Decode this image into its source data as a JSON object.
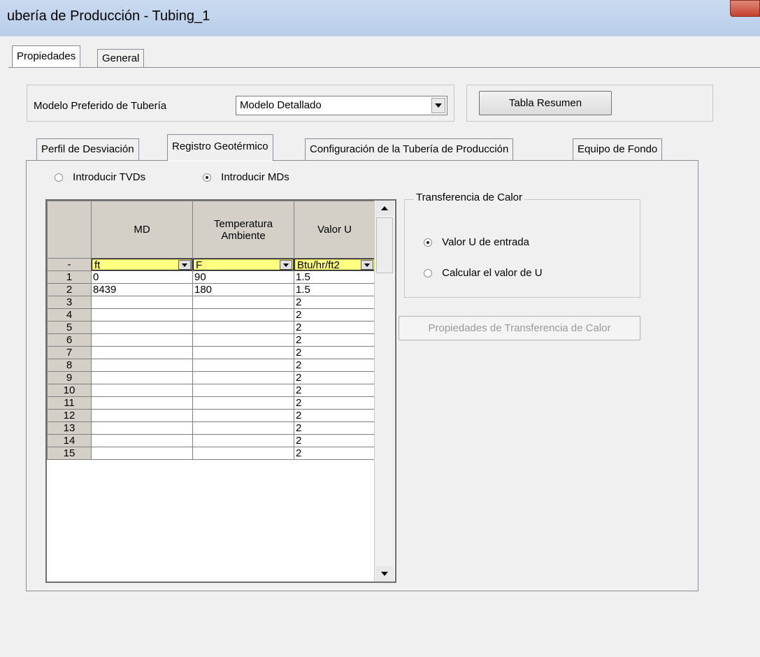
{
  "window": {
    "title": "ubería de Producción - Tubing_1"
  },
  "outer_tabs": [
    {
      "label": "Propiedades",
      "active": true
    },
    {
      "label": "General",
      "active": false
    }
  ],
  "model": {
    "label": "Modelo Preferido de Tubería",
    "selected": "Modelo Detallado",
    "summary_button": "Tabla Resumen"
  },
  "inner_tabs": [
    {
      "label": "Perfil de Desviación",
      "active": false
    },
    {
      "label": "Registro Geotérmico",
      "active": true
    },
    {
      "label": "Configuración de la Tubería de Producción",
      "active": false
    },
    {
      "label": "Equipo de Fondo",
      "active": false
    }
  ],
  "input_mode": {
    "options": [
      "Introducir TVDs",
      "Introducir MDs"
    ],
    "selected": "Introducir MDs"
  },
  "heat_transfer": {
    "group_label": "Transferencia de Calor",
    "options": [
      "Valor U de entrada",
      "Calcular el valor de U"
    ],
    "selected": "Valor U de entrada",
    "properties_button": "Propiedades de Transferencia de Calor"
  },
  "table": {
    "columns": [
      "MD",
      "Temperatura Ambiente",
      "Valor U"
    ],
    "unit_row_label": "-",
    "units": [
      "ft",
      "F",
      "Btu/hr/ft2"
    ],
    "rows": [
      {
        "n": "1",
        "md": "0",
        "temp": "90",
        "u": "1.5"
      },
      {
        "n": "2",
        "md": "8439",
        "temp": "180",
        "u": "1.5"
      },
      {
        "n": "3",
        "md": "",
        "temp": "",
        "u": "2"
      },
      {
        "n": "4",
        "md": "",
        "temp": "",
        "u": "2"
      },
      {
        "n": "5",
        "md": "",
        "temp": "",
        "u": "2"
      },
      {
        "n": "6",
        "md": "",
        "temp": "",
        "u": "2"
      },
      {
        "n": "7",
        "md": "",
        "temp": "",
        "u": "2"
      },
      {
        "n": "8",
        "md": "",
        "temp": "",
        "u": "2"
      },
      {
        "n": "9",
        "md": "",
        "temp": "",
        "u": "2"
      },
      {
        "n": "10",
        "md": "",
        "temp": "",
        "u": "2"
      },
      {
        "n": "11",
        "md": "",
        "temp": "",
        "u": "2"
      },
      {
        "n": "12",
        "md": "",
        "temp": "",
        "u": "2"
      },
      {
        "n": "13",
        "md": "",
        "temp": "",
        "u": "2"
      },
      {
        "n": "14",
        "md": "",
        "temp": "",
        "u": "2"
      },
      {
        "n": "15",
        "md": "",
        "temp": "",
        "u": "2"
      }
    ]
  }
}
